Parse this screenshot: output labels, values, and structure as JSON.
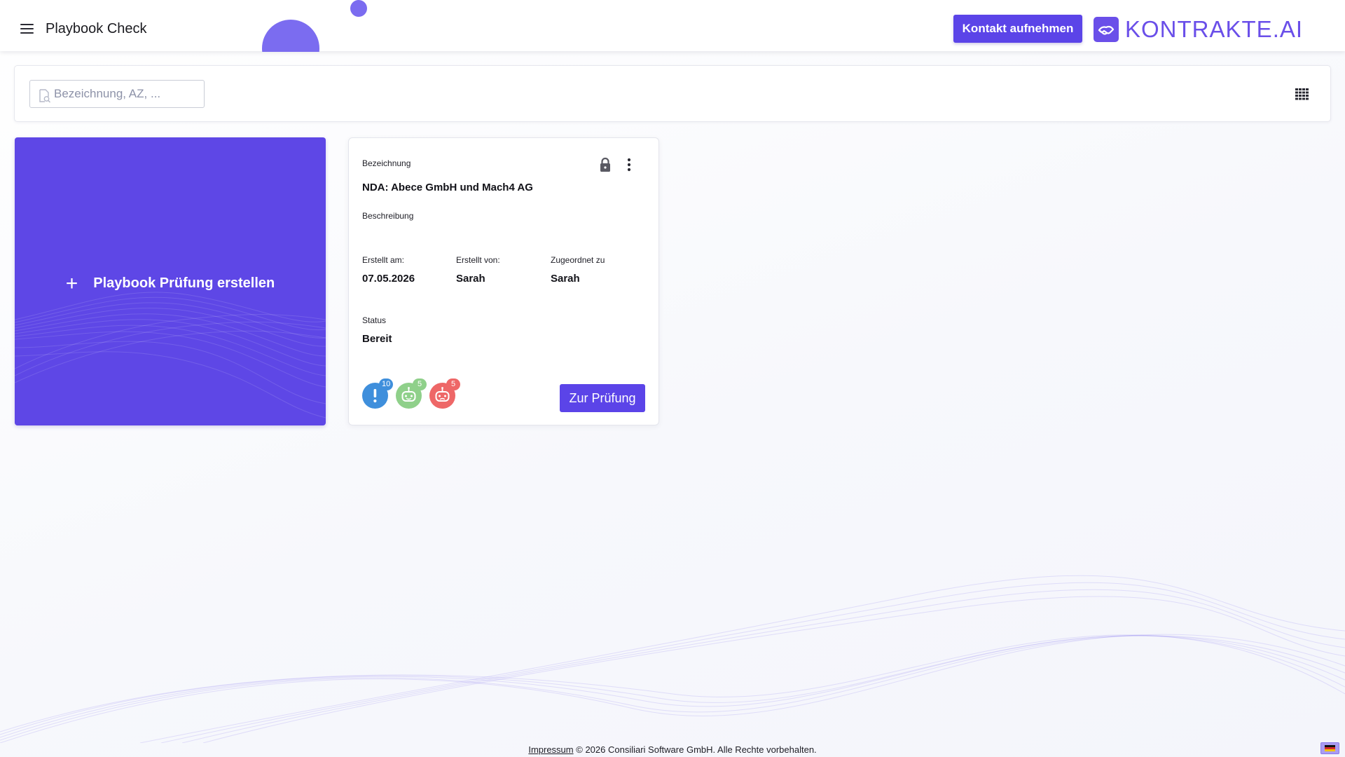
{
  "header": {
    "title": "Playbook Check",
    "contact_button": "Kontakt aufnehmen",
    "brand": "KONTRAKTE.AI"
  },
  "search": {
    "placeholder": "Bezeichnung, AZ, ..."
  },
  "create_card": {
    "plus": "+",
    "label": "Playbook Prüfung erstellen"
  },
  "playbook_card": {
    "name_label": "Bezeichnung",
    "name": "NDA: Abece GmbH und Mach4 AG",
    "description_label": "Beschreibung",
    "created_at_label": "Erstellt am:",
    "created_at": "07.05.2026",
    "created_by_label": "Erstellt von:",
    "created_by": "Sarah",
    "assigned_to_label": "Zugeordnet zu",
    "assigned_to": "Sarah",
    "status_label": "Status",
    "status": "Bereit",
    "badges": [
      {
        "icon": "exclamation-icon",
        "count": "10",
        "color": "#3f8fdc"
      },
      {
        "icon": "robot-happy-icon",
        "count": "5",
        "color": "#8fd08a"
      },
      {
        "icon": "robot-sad-icon",
        "count": "5",
        "color": "#ee6767"
      }
    ],
    "review_button": "Zur Prüfung"
  },
  "footer": {
    "imprint_link": "Impressum",
    "copyright": "© 2026 Consiliari Software GmbH. Alle Rechte vorbehalten."
  },
  "colors": {
    "accent": "#5b44e8",
    "brand": "#6a4fe9",
    "create_card": "#5e47e6"
  }
}
